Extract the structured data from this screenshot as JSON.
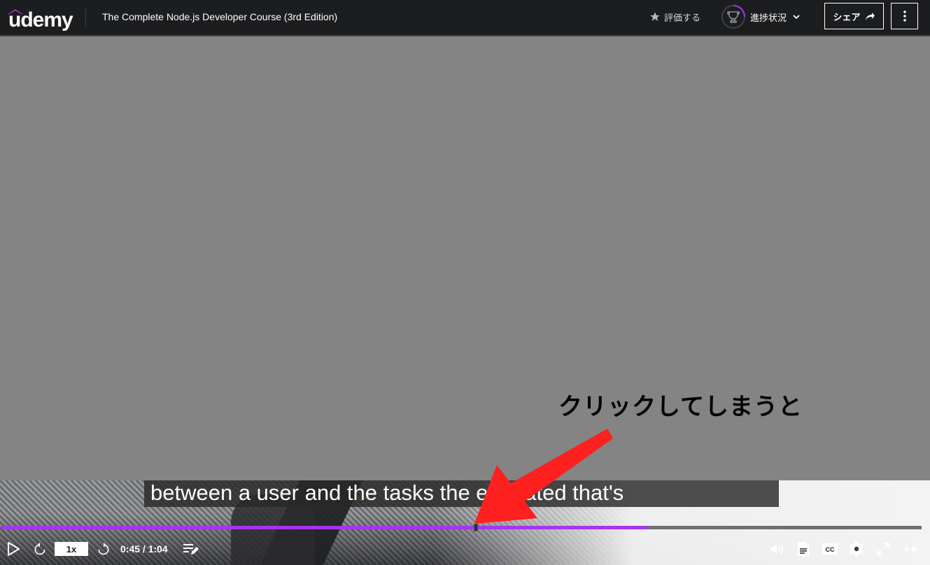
{
  "header": {
    "logo_text": "udemy",
    "course_title": "The Complete Node.js Developer Course (3rd Edition)",
    "rate_label": "評価する",
    "progress_label": "進捗状況",
    "share_label": "シェア"
  },
  "video": {
    "annotation": "クリックしてしまうと",
    "caption": "between a user and the tasks the     e created that's",
    "playback_fraction": 0.703
  },
  "controls": {
    "speed": "1x",
    "time": "0:45 / 1:04"
  },
  "colors": {
    "accent": "#a435f0",
    "header_bg": "#1c1d1f",
    "arrow": "#ff2020"
  },
  "icons": [
    "star-icon",
    "trophy-icon",
    "chevron-down-icon",
    "share-arrow-icon",
    "more-vertical-icon",
    "play-icon",
    "rewind-icon",
    "forward-icon",
    "notes-icon",
    "volume-icon",
    "transcript-icon",
    "captions-icon",
    "settings-icon",
    "fullscreen-icon",
    "collapse-icon"
  ]
}
